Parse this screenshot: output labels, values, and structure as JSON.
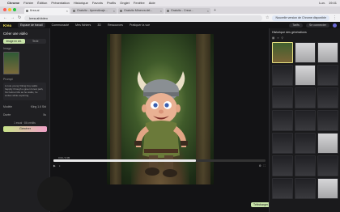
{
  "menubar": {
    "apple": "",
    "app": "Chrome",
    "items": [
      "Fichier",
      "Édition",
      "Présentation",
      "Historique",
      "Favoris",
      "Profils",
      "Onglet",
      "Fenêtre",
      "Aide"
    ],
    "right": [
      "Lun.",
      "19:41"
    ]
  },
  "browser": {
    "tabs": [
      {
        "title": "Krea.ai",
        "active": true
      },
      {
        "title": "Gratuito - Aprendizaje...",
        "active": false
      },
      {
        "title": "Gratuito Minerva del...",
        "active": false
      },
      {
        "title": "Gratuito - Crear...",
        "active": false
      }
    ],
    "url": "krea.ai/video",
    "ext_notice": "Nouvelle version de Chrome disponible"
  },
  "app_header": {
    "logo": "Krea",
    "workspace": "Espace de travail",
    "nav": [
      "Communauté",
      "Mes fichiers",
      "3D",
      "Ressources",
      "Pratiquer la vue"
    ],
    "right": [
      "Tarifs",
      "Se connecter"
    ]
  },
  "sidebar": {
    "title": "Créer une vidéo",
    "modes": [
      "Image en vid.",
      "Texte"
    ],
    "image_label": "Image",
    "prompt_label": "Prompt",
    "prompt_text": "A cute young Viking boy walks happily through a green forest path, his helmet tilts as he walks, he smiles while exploring.",
    "rows": [
      {
        "label": "Modèle",
        "value": "Kling 1.6 Std"
      },
      {
        "label": "Durée",
        "value": "5s"
      }
    ],
    "credits": "1 essai · 86 crédits",
    "generate": "Générer"
  },
  "player": {
    "timecode": "0:03 / 0:05",
    "progress": 0.67,
    "controls": [
      "play",
      "volume",
      "settings",
      "fullscreen"
    ],
    "download": "Télécharger"
  },
  "right_panel": {
    "title": "Historique des générations",
    "tools": [
      "grid-icon",
      "list-icon",
      "filter-icon"
    ],
    "thumbnails": [
      "selected",
      "figure",
      "figure",
      "dark",
      "figure",
      "dark",
      "dark",
      "dark",
      "dark",
      "dark",
      "dark",
      "dark",
      "dark",
      "dark",
      "figure",
      "dark",
      "dark",
      "dark",
      "dark",
      "dark",
      "figure"
    ]
  },
  "colors": {
    "accent": "#c8e4a9",
    "brand": "#f3e45a",
    "bg": "#1b1b1d"
  }
}
